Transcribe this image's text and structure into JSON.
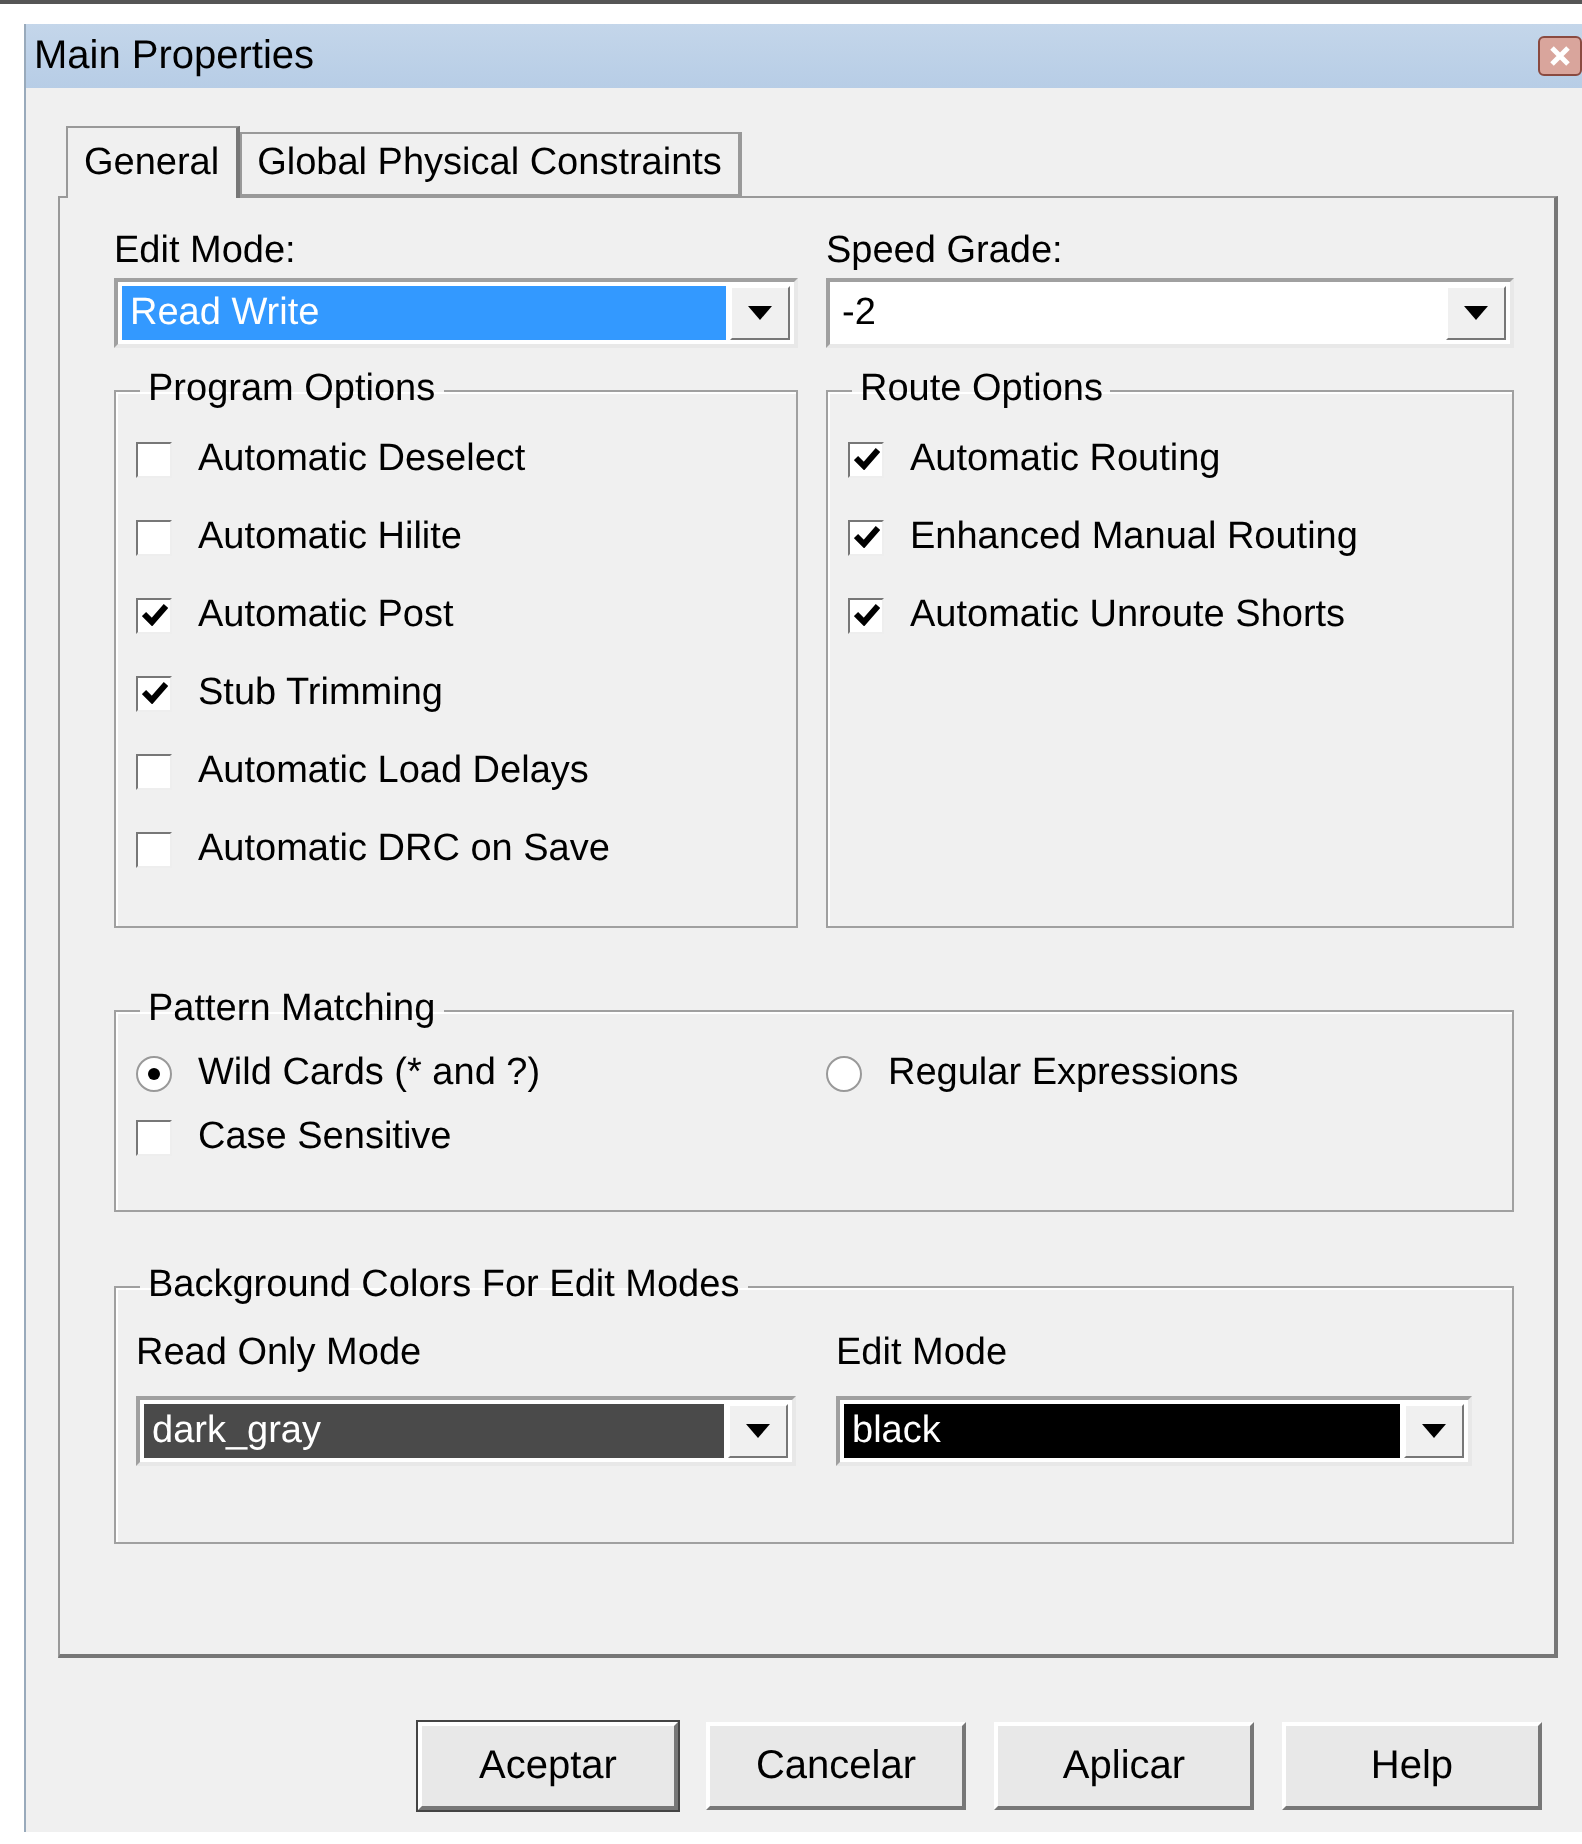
{
  "window": {
    "title": "Main Properties"
  },
  "tabs": [
    {
      "label": "General",
      "selected": true
    },
    {
      "label": "Global Physical Constraints",
      "selected": false
    }
  ],
  "edit_mode": {
    "label": "Edit Mode:",
    "value": "Read Write",
    "focused": true
  },
  "speed_grade": {
    "label": "Speed Grade:",
    "value": "-2",
    "focused": false
  },
  "program_options": {
    "title": "Program Options",
    "items": [
      {
        "label": "Automatic Deselect",
        "checked": false
      },
      {
        "label": "Automatic Hilite",
        "checked": false
      },
      {
        "label": "Automatic Post",
        "checked": true
      },
      {
        "label": "Stub Trimming",
        "checked": true
      },
      {
        "label": "Automatic Load Delays",
        "checked": false
      },
      {
        "label": "Automatic DRC on Save",
        "checked": false
      }
    ]
  },
  "route_options": {
    "title": "Route Options",
    "items": [
      {
        "label": "Automatic Routing",
        "checked": true
      },
      {
        "label": "Enhanced Manual Routing",
        "checked": true
      },
      {
        "label": "Automatic Unroute Shorts",
        "checked": true
      }
    ]
  },
  "pattern_matching": {
    "title": "Pattern Matching",
    "modes": [
      {
        "label": "Wild Cards (* and ?)",
        "selected": true
      },
      {
        "label": "Regular Expressions",
        "selected": false
      }
    ],
    "case_sensitive": {
      "label": "Case Sensitive",
      "checked": false
    }
  },
  "background_colors": {
    "title": "Background Colors For Edit Modes",
    "fields": [
      {
        "label": "Read Only Mode",
        "value": "dark_gray",
        "color": "#4a4a4a"
      },
      {
        "label": "Edit Mode",
        "value": "black",
        "color": "#000000"
      }
    ]
  },
  "buttons": [
    {
      "label": "Aceptar",
      "default": true
    },
    {
      "label": "Cancelar",
      "default": false
    },
    {
      "label": "Aplicar",
      "default": false
    },
    {
      "label": "Help",
      "default": false
    }
  ]
}
